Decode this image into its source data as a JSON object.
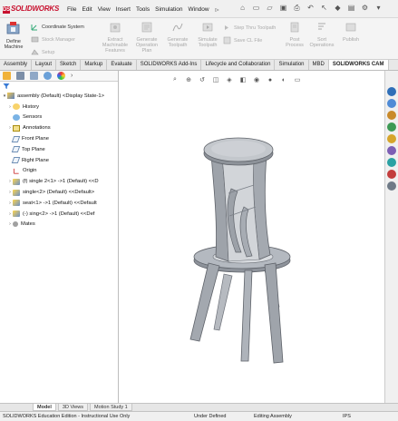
{
  "app": {
    "brand": "SOLIDWORKS"
  },
  "menu": [
    "File",
    "Edit",
    "View",
    "Insert",
    "Tools",
    "Simulation",
    "Window"
  ],
  "command_manager": {
    "define_machine": "Define Machine",
    "coordinate_system": "Coordinate System",
    "stock_manager": "Stock Manager",
    "setup": "Setup",
    "extract_features": "Extract Machinable Features",
    "generate_plan": "Generate Operation Plan",
    "generate_toolpath": "Generate Toolpath",
    "simulate_toolpath": "Simulate Toolpath",
    "step_thru": "Step Thru Toolpath",
    "save_cl": "Save CL File",
    "post_process": "Post Process",
    "sort_operations": "Sort Operations",
    "publish": "Publish"
  },
  "tabs": [
    "Assembly",
    "Layout",
    "Sketch",
    "Markup",
    "Evaluate",
    "SOLIDWORKS Add-Ins",
    "Lifecycle and Collaboration",
    "Simulation",
    "MBD",
    "SOLIDWORKS CAM"
  ],
  "active_tab": "SOLIDWORKS CAM",
  "tree": {
    "root": "assembly (Default) <Display State-1>",
    "items": [
      {
        "label": "History",
        "icon": "history-icon"
      },
      {
        "label": "Sensors",
        "icon": "sensor-icon"
      },
      {
        "label": "Annotations",
        "icon": "annotations-icon"
      },
      {
        "label": "Front Plane",
        "icon": "plane-icon"
      },
      {
        "label": "Top Plane",
        "icon": "plane-icon"
      },
      {
        "label": "Right Plane",
        "icon": "plane-icon"
      },
      {
        "label": "Origin",
        "icon": "origin-icon"
      },
      {
        "label": "(f) single 2<1> ->1 (Default) <<D",
        "icon": "part-icon"
      },
      {
        "label": "single<2> (Default) <<Default>",
        "icon": "part-icon"
      },
      {
        "label": "seat<1> ->1 (Default) <<Default",
        "icon": "part-icon"
      },
      {
        "label": "(-) sing<2> ->1 (Default) <<Def",
        "icon": "part-icon"
      },
      {
        "label": "Mates",
        "icon": "mates-icon"
      }
    ]
  },
  "bottom_tabs": [
    "Model",
    "3D Views",
    "Motion Study 1"
  ],
  "active_bottom_tab": "Model",
  "status": {
    "edition": "SOLIDWORKS Education Edition - Instructional Use Only",
    "state": "Under Defined",
    "mode": "Editing Assembly",
    "units": "IPS"
  },
  "colors": {
    "brand_red": "#c8102e",
    "model_gray": "#9ea3aa"
  }
}
